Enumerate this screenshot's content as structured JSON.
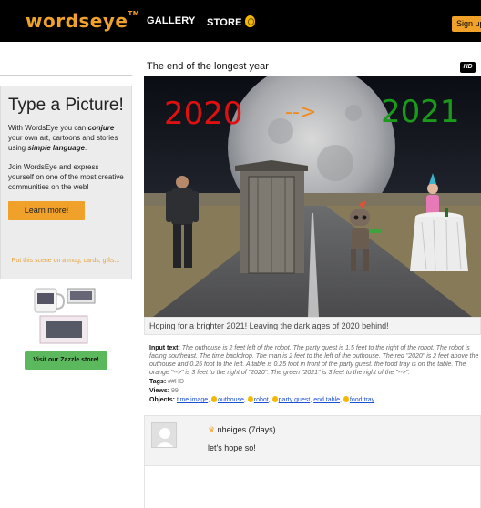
{
  "header": {
    "logo": "wordseye",
    "logo_tm": "TM",
    "nav": [
      {
        "label": "GALLERY"
      },
      {
        "label": "STORE"
      }
    ],
    "signup_label": "Sign up"
  },
  "sidebar": {
    "promo_title": "Type a Picture!",
    "promo_text_1_pre": "With WordsEye you can ",
    "promo_text_1_em": "conjure",
    "promo_text_1_mid": " your own art, cartoons and stories using ",
    "promo_text_1_em2": "simple language",
    "promo_text_1_end": ".",
    "promo_text_2": "Join WordsEye and express yourself on one of the most creative communities on the web!",
    "learn_more_label": "Learn more!",
    "zazzle_text": "Put this scene on a mug, cards, gifts...",
    "zazzle_button_label": "Visit our Zazzle store!"
  },
  "scene": {
    "title": "The end of the longest year",
    "hd_badge": "HD",
    "text_2020": "2020",
    "text_arrow": "-->",
    "text_2021": "2021",
    "caption": "Hoping for a brighter 2021! Leaving the dark ages of 2020 behind!",
    "input_label": "Input text:",
    "input_text": "The outhouse is 2 feet left of the robot. The party guest is 1.5 feet to the right of the robot. The robot is facing southeast. The time backdrop. The man is 2 feet to the left of the outhouse. The red \"2020\" is 2 feet above the outhouse and 0.25 foot to the left. A table is 0.25 foot in front of the party guest. the food tray is on the table. The orange \"-->\" is 3 feet to the right of \"2020\". The green \"2021\" is 3 feet to the right of the \"-->\".",
    "tags_label": "Tags:",
    "tags_value": "##HD",
    "views_label": "Views:",
    "views_value": "99",
    "objects_label": "Objects:",
    "objects": [
      {
        "name": "time image",
        "coin": false
      },
      {
        "name": "outhouse",
        "coin": true
      },
      {
        "name": "robot",
        "coin": true
      },
      {
        "name": "party guest",
        "coin": true
      },
      {
        "name": "end table",
        "coin": false
      },
      {
        "name": "food tray",
        "coin": true
      }
    ]
  },
  "comments": [
    {
      "author": "nheiges",
      "age": "(7days)",
      "text": "let's hope so!"
    }
  ],
  "colors": {
    "accent": "#f0a12a",
    "zazzle_green": "#5cb85c",
    "red_2020": "#e01010",
    "orange_arrow": "#f08a1c",
    "green_2021": "#1a9a1a"
  }
}
